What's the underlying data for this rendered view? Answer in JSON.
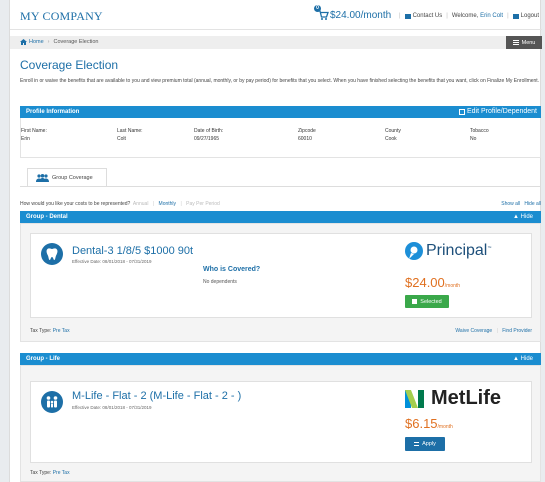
{
  "header": {
    "company": "MY COMPANY",
    "cart_badge": "0",
    "cart_total": "$24.00/month",
    "contact": "Contact Us",
    "welcome": "Welcome,",
    "user_name": "Erin Colt",
    "logout": "Logout"
  },
  "breadcrumb": {
    "home": "Home",
    "current": "Coverage Election"
  },
  "menu_label": "Menu",
  "page_title": "Coverage Election",
  "intro": "Enroll in or waive the benefits that are available to you and view premium total (annual, monthly, or by pay period) for benefits that you select. When you have finished selecting the benefits that you want, click on Finalize My Enrollment.",
  "profile": {
    "title": "Profile Information",
    "edit_label": "Edit Profile/Dependent",
    "fields": [
      {
        "label": "First Name:",
        "value": "Erin"
      },
      {
        "label": "Last Name:",
        "value": "Colt"
      },
      {
        "label": "Date of Birth:",
        "value": "09/27/1965"
      },
      {
        "label": "Zipcode",
        "value": "60010"
      },
      {
        "label": "County",
        "value": "Cook"
      },
      {
        "label": "Tobacco",
        "value": "No"
      }
    ]
  },
  "tabs": [
    {
      "label": "Group Coverage",
      "icon": "group-icon"
    }
  ],
  "cost_view": {
    "question": "How would you like your costs to be represented?",
    "options": [
      "Annual",
      "Monthly",
      "Pay Per Period"
    ],
    "selected": "Monthly",
    "show_all": "Show all",
    "hide_all": "Hide all"
  },
  "groups": [
    {
      "title": "Group - Dental",
      "hide_label": "Hide",
      "plan_name": "Dental-3 1/8/5 $1000 90t",
      "effective": "Effective Date: 08/01/2018 - 07/31/2019",
      "who_label": "Who is Covered?",
      "who_value": "No dependents",
      "carrier": "Principal",
      "price": "$24.00",
      "price_unit": "/month",
      "action_label": "Selected",
      "tax_label": "Tax Type:",
      "tax_value": "Pre Tax",
      "waive_label": "Waive Coverage",
      "provider_label": "Find Provider"
    },
    {
      "title": "Group - Life",
      "hide_label": "Hide",
      "plan_name": "M-Life - Flat - 2 (M-Life - Flat - 2 - )",
      "effective": "Effective Date: 08/01/2018 - 07/31/2019",
      "carrier": "MetLife",
      "price": "$6.15",
      "price_unit": "/month",
      "action_label": "Apply",
      "tax_label": "Tax Type:",
      "tax_value": "Pre Tax"
    }
  ],
  "colors": {
    "brand": "#1d6fa7",
    "panel": "#1b8dd0",
    "price": "#e07020",
    "selected": "#3aa84a"
  }
}
